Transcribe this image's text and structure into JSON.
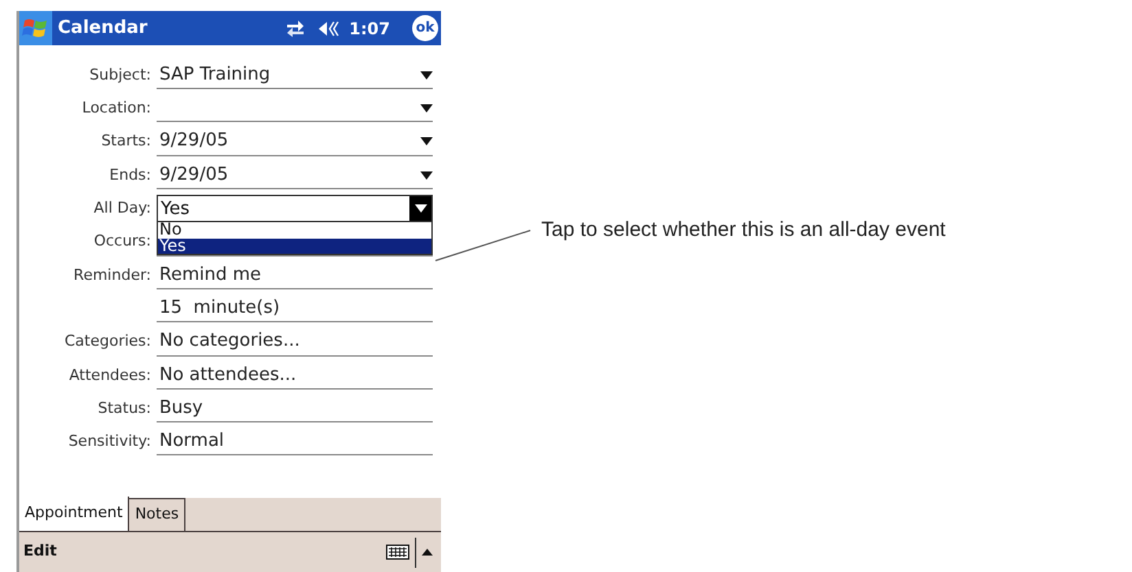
{
  "window": {
    "title": "Calendar",
    "time": "1:07",
    "ok": "ok"
  },
  "fields": [
    {
      "kind": "dropdown",
      "label": "Subject:",
      "value": "SAP Training"
    },
    {
      "kind": "dropdown",
      "label": "Location:"
    },
    {
      "kind": "dropdown",
      "label": "Starts:",
      "value": "9/29/05"
    },
    {
      "kind": "dropdown",
      "label": "Ends:",
      "value": "9/29/05"
    },
    {
      "kind": "combo",
      "label": "All Day:",
      "value": "Yes",
      "expanded": true,
      "options": [
        {
          "label": "No",
          "selected": false
        },
        {
          "label": "Yes",
          "selected": true
        }
      ]
    },
    {
      "kind": "text",
      "label": "Occurs:"
    },
    {
      "kind": "text",
      "label": "Reminder:",
      "value": "Remind me"
    },
    {
      "kind": "text",
      "value": "15  minute(s)"
    },
    {
      "kind": "text",
      "label": "Categories:",
      "value": "No categories..."
    },
    {
      "kind": "text",
      "label": "Attendees:",
      "value": "No attendees..."
    },
    {
      "kind": "text",
      "label": "Status:",
      "value": "Busy"
    },
    {
      "kind": "text",
      "label": "Sensitivity:",
      "value": "Normal"
    }
  ],
  "tabs": [
    {
      "label": "Appointment",
      "selected": true
    },
    {
      "label": "Notes",
      "selected": false
    }
  ],
  "menu_bar": {
    "items": [
      "Edit"
    ]
  },
  "callout": "Tap to select whether this is an all-day event"
}
